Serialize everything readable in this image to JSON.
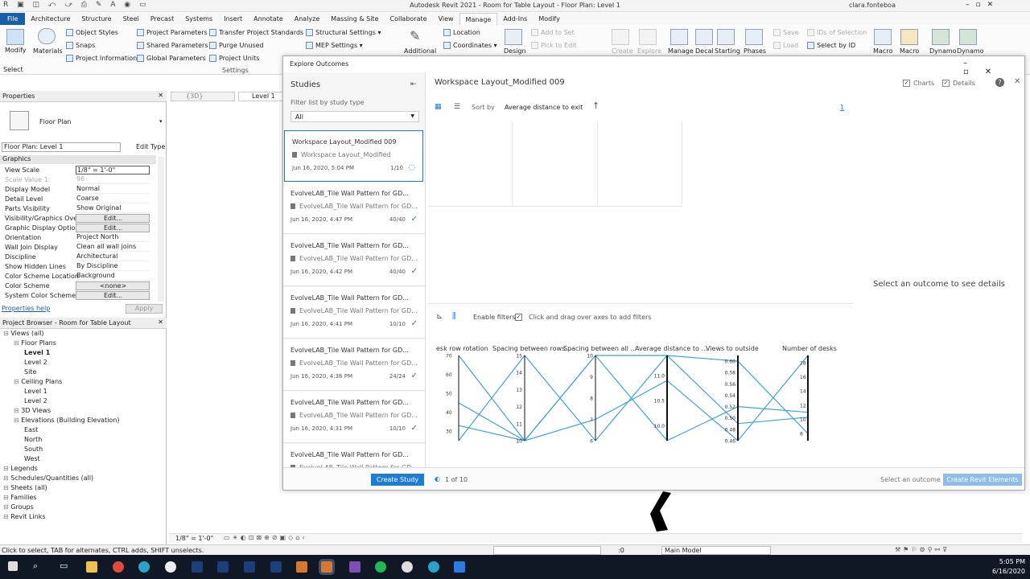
{
  "titlebar": {
    "title": "Autodesk Revit 2021 - Room for Table Layout - Floor Plan: Level 1",
    "user": "clara.fonteboa"
  },
  "menu": [
    "File",
    "Architecture",
    "Structure",
    "Steel",
    "Precast",
    "Systems",
    "Insert",
    "Annotate",
    "Analyze",
    "Massing & Site",
    "Collaborate",
    "View",
    "Manage",
    "Add-Ins",
    "Modify"
  ],
  "menu_active": "Manage",
  "ribbon": {
    "modify": "Modify",
    "select": "Select",
    "materials": "Materials",
    "object_styles": "Object Styles",
    "snaps": "Snaps",
    "project_information": "Project Information",
    "project_parameters": "Project Parameters",
    "shared_parameters": "Shared Parameters",
    "global_parameters": "Global Parameters",
    "transfer_standards": "Transfer Project Standards",
    "purge_unused": "Purge Unused",
    "project_units": "Project Units",
    "settings_group": "Settings",
    "structural_settings": "Structural Settings",
    "mep_settings": "MEP Settings",
    "additional": "Additional",
    "location": "Location",
    "coordinates": "Coordinates",
    "design": "Design",
    "add_to_set": "Add to Set",
    "pick_to_edit": "Pick to Edit",
    "create": "Create",
    "explore": "Explore",
    "manage": "Manage",
    "decal": "Decal",
    "starting": "Starting",
    "phases": "Phases",
    "save": "Save",
    "load": "Load",
    "ids_of_selection": "IDs of Selection",
    "select_by_id": "Select by ID",
    "macro1": "Macro",
    "macro2": "Macro",
    "dynamo1": "Dynamo",
    "dynamo2": "Dynamo"
  },
  "properties": {
    "header": "Properties",
    "type": "Floor Plan",
    "selector": "Floor Plan: Level 1",
    "edit_type": "Edit Type",
    "group": "Graphics",
    "rows": [
      {
        "k": "View Scale",
        "v": "1/8\" = 1'-0\""
      },
      {
        "k": "Scale Value   1:",
        "v": "96"
      },
      {
        "k": "Display Model",
        "v": "Normal"
      },
      {
        "k": "Detail Level",
        "v": "Coarse"
      },
      {
        "k": "Parts Visibility",
        "v": "Show Original"
      },
      {
        "k": "Visibility/Graphics Ove...",
        "v": "Edit..."
      },
      {
        "k": "Graphic Display Options",
        "v": "Edit..."
      },
      {
        "k": "Orientation",
        "v": "Project North"
      },
      {
        "k": "Wall Join Display",
        "v": "Clean all wall joins"
      },
      {
        "k": "Discipline",
        "v": "Architectural"
      },
      {
        "k": "Show Hidden Lines",
        "v": "By Discipline"
      },
      {
        "k": "Color Scheme Location",
        "v": "Background"
      },
      {
        "k": "Color Scheme",
        "v": "<none>"
      },
      {
        "k": "System Color Schemes",
        "v": "Edit..."
      }
    ],
    "help": "Properties help",
    "apply": "Apply"
  },
  "browser": {
    "header": "Project Browser - Room for Table Layout",
    "items": [
      {
        "t": "Views (all)",
        "lvl": 0
      },
      {
        "t": "Floor Plans",
        "lvl": 1
      },
      {
        "t": "Level 1",
        "lvl": 2,
        "bold": true
      },
      {
        "t": "Level 2",
        "lvl": 2
      },
      {
        "t": "Site",
        "lvl": 2
      },
      {
        "t": "Ceiling Plans",
        "lvl": 1
      },
      {
        "t": "Level 1",
        "lvl": 2
      },
      {
        "t": "Level 2",
        "lvl": 2
      },
      {
        "t": "3D Views",
        "lvl": 1
      },
      {
        "t": "Elevations (Building Elevation)",
        "lvl": 1
      },
      {
        "t": "East",
        "lvl": 2
      },
      {
        "t": "North",
        "lvl": 2
      },
      {
        "t": "South",
        "lvl": 2
      },
      {
        "t": "West",
        "lvl": 2
      },
      {
        "t": "Legends",
        "lvl": 0
      },
      {
        "t": "Schedules/Quantities (all)",
        "lvl": 0
      },
      {
        "t": "Sheets (all)",
        "lvl": 0
      },
      {
        "t": "Families",
        "lvl": 0
      },
      {
        "t": "Groups",
        "lvl": 0
      },
      {
        "t": "Revit Links",
        "lvl": 0
      }
    ]
  },
  "view_tabs": [
    "{3D}",
    "Level 1"
  ],
  "dialog": {
    "title": "Explore Outcomes",
    "studies_title": "Studies",
    "filter_label": "Filter list by study type",
    "filter_value": "All",
    "studies": [
      {
        "t": "Workspace Layout_Modified 009",
        "s": "Workspace Layout_Modified",
        "d": "Jun 16, 2020, 5:04 PM",
        "c": "1/10"
      },
      {
        "t": "EvolveLAB_Tile Wall Pattern for GD...",
        "s": "EvolveLAB_Tile Wall Pattern for GD...",
        "d": "Jun 16, 2020, 4:47 PM",
        "c": "40/40"
      },
      {
        "t": "EvolveLAB_Tile Wall Pattern for GD...",
        "s": "EvolveLAB_Tile Wall Pattern for GD...",
        "d": "Jun 16, 2020, 4:42 PM",
        "c": "40/40"
      },
      {
        "t": "EvolveLAB_Tile Wall Pattern for GD...",
        "s": "EvolveLAB_Tile Wall Pattern for GD...",
        "d": "Jun 16, 2020, 4:41 PM",
        "c": "10/10"
      },
      {
        "t": "EvolveLAB_Tile Wall Pattern for GD...",
        "s": "EvolveLAB_Tile Wall Pattern for GD...",
        "d": "Jun 16, 2020, 4:36 PM",
        "c": "24/24"
      },
      {
        "t": "EvolveLAB_Tile Wall Pattern for GD...",
        "s": "EvolveLAB_Tile Wall Pattern for GD...",
        "d": "Jun 16, 2020, 4:31 PM",
        "c": "10/10"
      },
      {
        "t": "EvolveLAB_Tile Wall Pattern for GD...",
        "s": "EvolveLAB_Tile Wall Pattern for GD...",
        "d": "",
        "c": ""
      }
    ],
    "main_title": "Workspace Layout_Modified 009",
    "charts": "Charts",
    "details": "Details",
    "sort_by": "Sort by",
    "sort_value": "Average distance to exits",
    "page": "1",
    "enable_filters": "Enable filters",
    "filter_hint": "Click and drag over axes to add filters",
    "details_placeholder": "Select an outcome to see details",
    "create_study": "Create Study",
    "progress": "1 of 10",
    "select_outcome": "Select an outcome",
    "create_revit": "Create Revit Elements"
  },
  "chart_data": {
    "type": "parallel-coordinates",
    "axes": [
      {
        "label": "Desk row rotation",
        "shown": "esk row rotation",
        "ticks": [
          "70",
          "60",
          "50",
          "40",
          "30"
        ],
        "min": 25,
        "max": 70
      },
      {
        "label": "Spacing between rows...",
        "ticks": [
          "15",
          "14",
          "13",
          "12",
          "11",
          "10"
        ],
        "min": 10,
        "max": 15
      },
      {
        "label": "Spacing between all ...",
        "ticks": [
          "10",
          "9",
          "8",
          "7",
          "6"
        ],
        "min": 6,
        "max": 10
      },
      {
        "label": "Average distance to ...",
        "ticks": [
          "11.0",
          "10.5",
          "10.0"
        ],
        "min": 9.7,
        "max": 11.4
      },
      {
        "label": "Views to outside",
        "ticks": [
          "0.60",
          "0.58",
          "0.56",
          "0.54",
          "0.52",
          "0.50",
          "0.48",
          "0.46"
        ],
        "min": 0.46,
        "max": 0.61
      },
      {
        "label": "Number of desks",
        "ticks": [
          "18",
          "16",
          "14",
          "12",
          "10",
          "8"
        ],
        "min": 7,
        "max": 19
      }
    ],
    "series": [
      {
        "values": [
          70,
          10,
          10,
          11.4,
          0.49,
          10.3
        ]
      },
      {
        "values": [
          25,
          15,
          6,
          11.4,
          0.6,
          8
        ]
      },
      {
        "values": [
          45,
          10,
          10,
          9.7,
          0.52,
          11
        ]
      },
      {
        "values": [
          33,
          10,
          7,
          10.9,
          0.46,
          19
        ]
      }
    ]
  },
  "status": {
    "hint": "Click to select, TAB for alternates, CTRL adds, SHIFT unselects.",
    "scale": "1/8\" = 1'-0\"",
    "model": "Main Model",
    "zero": ":0"
  },
  "clock": {
    "time": "5:05 PM",
    "date": "6/16/2020"
  }
}
